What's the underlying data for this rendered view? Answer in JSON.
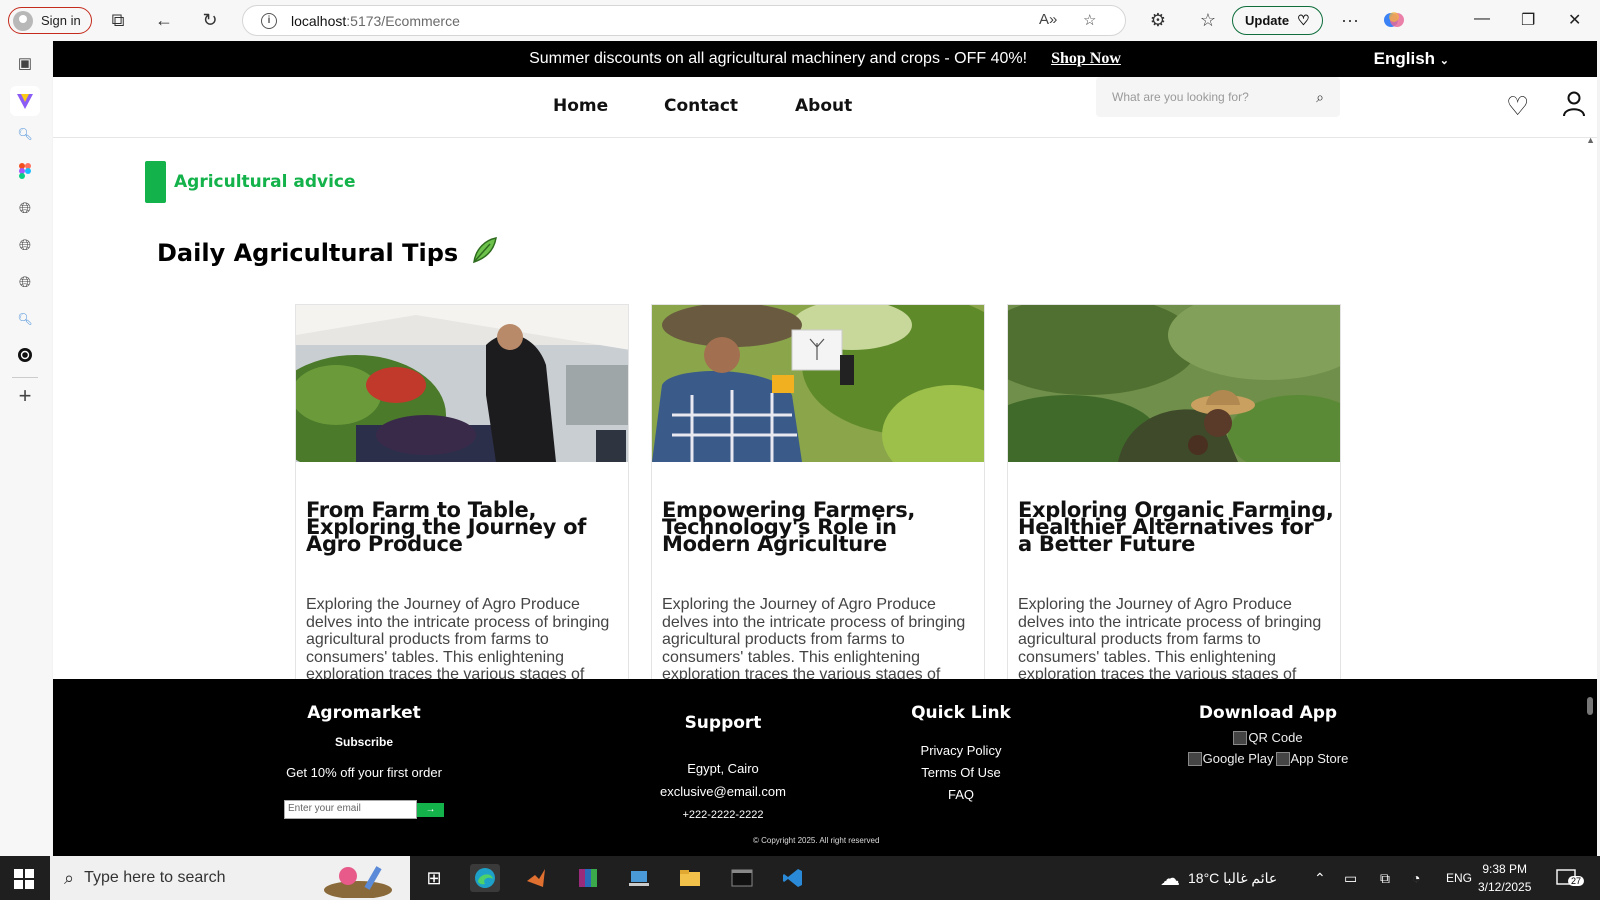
{
  "browser": {
    "signin": "Sign in",
    "url_host": "localhost",
    "url_path": ":5173/Ecommerce",
    "update": "Update"
  },
  "site": {
    "promo_text": "Summer discounts on all agricultural machinery and crops - OFF 40%!",
    "promo_link": "Shop Now",
    "language": "English",
    "nav": [
      "Home",
      "Contact",
      "About"
    ],
    "search_placeholder": "What are you looking for?",
    "section_tag": "Agricultural advice",
    "section_title": "Daily Agricultural Tips",
    "cards": [
      {
        "title": "From Farm to Table, Exploring the Journey of Agro Produce",
        "body": "Exploring the Journey of Agro Produce delves into the intricate process of bringing agricultural products from farms to consumers' tables. This enlightening exploration traces the various stages of"
      },
      {
        "title": "Empowering Farmers, Technology's Role in Modern Agriculture",
        "body": "Exploring the Journey of Agro Produce delves into the intricate process of bringing agricultural products from farms to consumers' tables. This enlightening exploration traces the various stages of"
      },
      {
        "title": "Exploring Organic Farming, Healthier Alternatives for a Better Future",
        "body": "Exploring the Journey of Agro Produce delves into the intricate process of bringing agricultural products from farms to consumers' tables. This enlightening exploration traces the various stages of"
      }
    ],
    "footer": {
      "brand": "Agromarket",
      "subscribe": "Subscribe",
      "offer": "Get 10% off your first order",
      "email_placeholder": "Enter your email",
      "support_title": "Support",
      "address": "Egypt, Cairo",
      "email": "exclusive@email.com",
      "phone": "+222-2222-2222",
      "quick_title": "Quick Link",
      "links": [
        "Privacy Policy",
        "Terms Of Use",
        "FAQ"
      ],
      "download_title": "Download App",
      "qr_alt": "QR Code",
      "gplay_alt": "Google Play",
      "appstore_alt": "App Store",
      "copyright": "© Copyright 2025. All right reserved"
    }
  },
  "taskbar": {
    "search_placeholder": "Type here to search",
    "weather": "18°C عائم غالبا",
    "lang": "ENG",
    "time": "9:38 PM",
    "date": "3/12/2025",
    "notifications": "27"
  }
}
